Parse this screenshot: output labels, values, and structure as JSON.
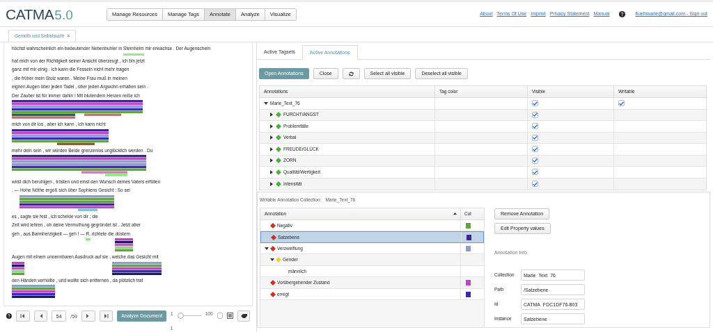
{
  "app": {
    "logo": "CATMA",
    "version": "5.0"
  },
  "nav": [
    {
      "label": "Manage Resources",
      "selected": false
    },
    {
      "label": "Manage Tags",
      "selected": false
    },
    {
      "label": "Annotate",
      "selected": true
    },
    {
      "label": "Analyze",
      "selected": false
    },
    {
      "label": "Visualize",
      "selected": false
    }
  ],
  "header_links": [
    "About",
    "Terms Of Use",
    "Imprint",
    "Privacy Statement",
    "Manual"
  ],
  "account": "fluehmarie@gmail.com - Sign out",
  "document_tabs": [
    {
      "label": "Gemüth und Selbstsucht",
      "close": "×",
      "selected": true
    }
  ],
  "text_lines": [
    "höchst wahrscheinlich ein bedeutender Nebenbuhler in Sternheim mir erwachse . Der Augenschein",
    "hat mich von der Richtigkeit seiner Ansicht überzeugt , ich bin jetzt",
    "ganz mit mir einig . Ich kann die Fesseln nicht mehr tragen",
    ", die früher mein Stolz waren . Meine Frau muß in meinen",
    "eignen Augen über jeden Tadel , über jeden Argwohn erhaben sein .",
    "Der Zauber ist für immer dahin ! Mit blutendem Herzen reiße ich",
    "mich von dir los , aber ich kann , ich kann nicht",
    "mehr dein sein , wir würden Beide grenzenlos unglücklich werden . Du",
    "wirst dich beruhigen , trösten und einst den Wunsch deines Vaters erfüllen",
    ". — Hohe Nöthe ergoß sich über Sophiens Gesicht : So sei",
    "es , sagte sie fest , ich scheide von dir ; die",
    "Zeit wird lehren , ob deine Vermuthung gegründet ist . Jetzt aber",
    "geh , aus Barmherzigkeit — geh ! — R. richtete die düstern",
    "Augen mit einem unnennbaren Ausdruck auf sie , welche das Gesicht mit",
    "den Händen verhüllte , und wollte sich entfernen , da plötzlich trat"
  ],
  "pager": {
    "page": "54",
    "total": "/59",
    "analyze": "Analyze Document",
    "slider_min": "1",
    "slider_max": "100",
    "slider_value": "1",
    "level": 0,
    "checked": false
  },
  "panel_tabs": [
    {
      "label": "Active Tagsets",
      "selected": false
    },
    {
      "label": "Active Annotations",
      "selected": true
    }
  ],
  "toolbar": {
    "open": "Open Annotations",
    "close": "Close",
    "select_all": "Select all visible",
    "deselect_all": "Deselect all visible"
  },
  "annotations_table": {
    "columns": [
      "Annotations",
      "Tag color",
      "Visible",
      "Writable"
    ],
    "rows": [
      {
        "label": "Marie_Text_76",
        "kind": "collection",
        "expanded": true,
        "visible": true,
        "writable": true
      },
      {
        "label": "FURCHT/ANGST",
        "kind": "tagset",
        "expanded": false,
        "visible": true
      },
      {
        "label": "Problemfälle",
        "kind": "tagset",
        "expanded": false,
        "visible": true
      },
      {
        "label": "Verbal",
        "kind": "tagset",
        "expanded": false,
        "visible": true
      },
      {
        "label": "FREUDE/GLÜCK",
        "kind": "tagset",
        "expanded": false,
        "visible": true
      },
      {
        "label": "ZORN",
        "kind": "tagset",
        "expanded": false,
        "visible": true
      },
      {
        "label": "Qualität/Wertigkeit",
        "kind": "tagset",
        "expanded": false,
        "visible": true
      },
      {
        "label": "Intensität",
        "kind": "tagset",
        "expanded": false,
        "visible": true
      }
    ]
  },
  "writable_collection": {
    "label": "Writable Annotation Collection:",
    "name": "Marie_Text_76"
  },
  "annotation_table": {
    "columns": [
      "Annotation",
      "Col"
    ],
    "rows": [
      {
        "label": "Negativ",
        "kind": "tag",
        "color": "#5aaa30",
        "selected": false
      },
      {
        "label": "Satzebene",
        "kind": "tag",
        "color": "#3b2a8a",
        "selected": true
      },
      {
        "label": "Verzweiflung",
        "kind": "tag",
        "color": "#8aa0d0",
        "selected": false,
        "expanded": true,
        "children": [
          {
            "label": "Gender",
            "kind": "property",
            "selected": false,
            "expanded": true,
            "children": [
              {
                "label": "männlich",
                "kind": "value",
                "selected": false
              }
            ]
          }
        ]
      },
      {
        "label": "Vorübergehender Zustand",
        "kind": "tag",
        "color": "#c040d8",
        "selected": false
      },
      {
        "label": "erregt",
        "kind": "tag",
        "color": "#3a28c0",
        "selected": false
      }
    ]
  },
  "actions": [
    "Remove Annotation",
    "Edit Property values"
  ],
  "info": {
    "title": "Annotation Info",
    "fields": [
      {
        "label": "Collection",
        "value": "Marie_Text_76"
      },
      {
        "label": "Path",
        "value": "/Satzebene"
      },
      {
        "label": "Id",
        "value": "CATMA_FDC1DF76-803"
      },
      {
        "label": "Instance",
        "value": "Satzebene"
      }
    ]
  }
}
